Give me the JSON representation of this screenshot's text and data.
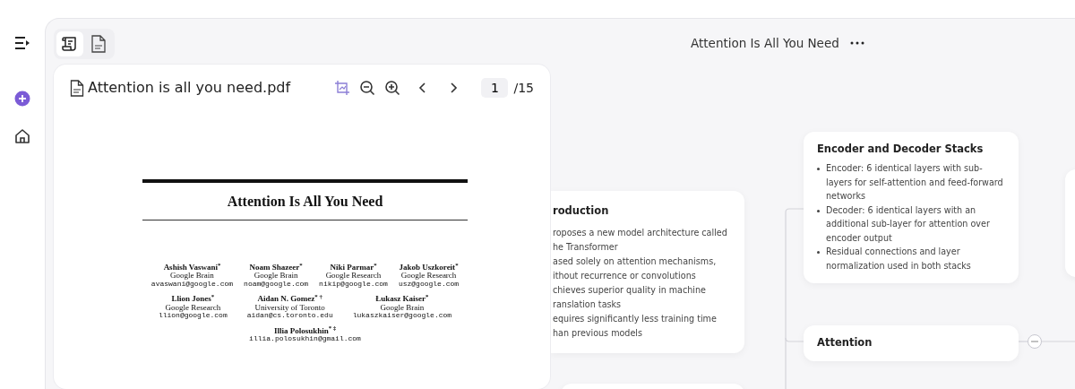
{
  "sidebar": {
    "items": [
      {
        "kind": "menu"
      },
      {
        "kind": "add"
      },
      {
        "kind": "home"
      }
    ]
  },
  "tabs": [
    {
      "kind": "notes",
      "selected": true
    },
    {
      "kind": "pdf",
      "selected": false
    }
  ],
  "pdf_viewer": {
    "file_name": "Attention is all you need.pdf",
    "page": "1",
    "page_count": "/15",
    "paper": {
      "title": "Attention Is All You Need",
      "author_rows": [
        [
          {
            "name": "Ashish Vaswani",
            "mark": "$^{*}$",
            "affiliation": "Google Brain",
            "email": "avaswani@google.com"
          },
          {
            "name": "Noam Shazeer",
            "mark": "$^{*}$",
            "affiliation": "Google Brain",
            "email": "noam@google.com"
          },
          {
            "name": "Niki Parmar",
            "mark": "$^{*}$",
            "affiliation": "Google Research",
            "email": "nikip@google.com"
          },
          {
            "name": "Jakob Uszkoreit",
            "mark": "$^{*}$",
            "affiliation": "Google Research",
            "email": "usz@google.com"
          }
        ],
        [
          {
            "name": "Llion Jones",
            "mark": "$^{*}$",
            "affiliation": "Google Research",
            "email": "llion@google.com"
          },
          {
            "name": "Aidan N. Gomez",
            "mark": "$^{* †}$",
            "affiliation": "University of Toronto",
            "email": "aidan@cs.toronto.edu"
          },
          {
            "name": "Łukasz Kaiser",
            "mark": "$^{*}$",
            "affiliation": "Google Brain",
            "email": "lukaszkaiser@google.com"
          }
        ],
        [
          {
            "name": "Illia Polosukhin",
            "mark": "$^{* ‡}$",
            "email": "illia.polosukhin@gmail.com"
          }
        ]
      ]
    }
  },
  "mind_map": {
    "title": "Attention Is All You Need",
    "nodes": [
      {
        "kind": "detail",
        "title": "roduction",
        "items": [
          [
            "roposes a new model architecture called",
            "he Transformer"
          ],
          [
            "ased solely on attention mechanisms,",
            "ithout recurrence or convolutions"
          ],
          [
            "chieves superior quality in machine",
            "ranslation tasks"
          ],
          [
            "equires significantly less training time",
            "han previous models"
          ]
        ]
      },
      {
        "kind": "bulleted",
        "title": "Encoder and Decoder Stacks",
        "items": [
          "Encoder: 6 identical layers with sub-layers for self-attention and feed-forward networks",
          "Decoder: 6 identical layers with an additional sub-layer for attention over encoder output",
          "Residual connections and layer normalization used in both stacks"
        ]
      },
      {
        "kind": "heading",
        "title": "Attention",
        "expanded": true
      }
    ]
  }
}
